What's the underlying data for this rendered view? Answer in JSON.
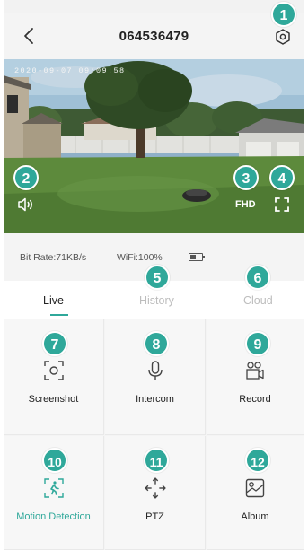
{
  "header": {
    "title": "064536479"
  },
  "video": {
    "timestamp": "2020-09-07 09:09:58",
    "quality_label": "FHD"
  },
  "info": {
    "bitrate": "Bit Rate:71KB/s",
    "wifi": "WiFi:100%"
  },
  "tabs": [
    {
      "label": "Live",
      "active": true
    },
    {
      "label": "History",
      "active": false
    },
    {
      "label": "Cloud",
      "active": false
    }
  ],
  "actions": [
    {
      "label": "Screenshot",
      "icon": "screenshot-icon"
    },
    {
      "label": "Intercom",
      "icon": "microphone-icon"
    },
    {
      "label": "Record",
      "icon": "video-camera-icon"
    },
    {
      "label": "Motion Detection",
      "icon": "motion-detection-icon"
    },
    {
      "label": "PTZ",
      "icon": "ptz-arrows-icon"
    },
    {
      "label": "Album",
      "icon": "album-icon"
    }
  ],
  "badges": [
    "1",
    "2",
    "3",
    "4",
    "5",
    "6",
    "7",
    "8",
    "9",
    "10",
    "11",
    "12"
  ],
  "colors": {
    "accent": "#2fa89a",
    "inactive_tab": "#bdbdbd",
    "panel_bg": "#f4f4f4"
  }
}
